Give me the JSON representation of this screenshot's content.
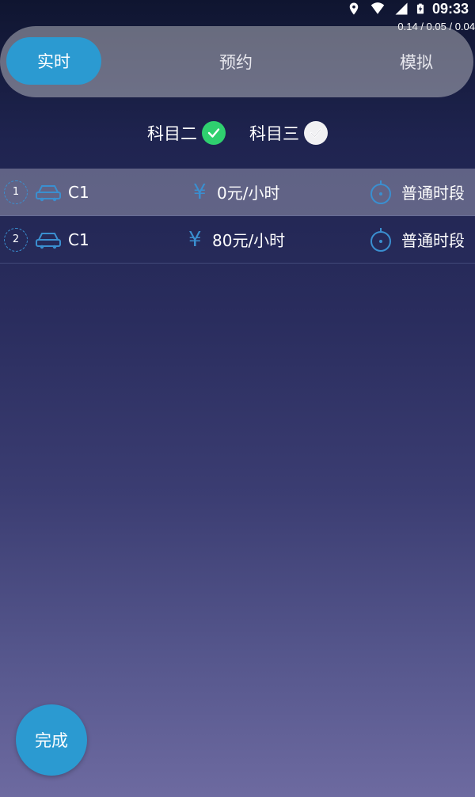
{
  "status": {
    "time": "09:33",
    "net_speed": "0.14 / 0.05 / 0.04"
  },
  "tabs": [
    {
      "label": "实时",
      "active": true
    },
    {
      "label": "预约",
      "active": false
    },
    {
      "label": "模拟",
      "active": false
    }
  ],
  "subjects": [
    {
      "label": "科目二",
      "checked": true,
      "check_color": "#2fd06f"
    },
    {
      "label": "科目三",
      "checked": true,
      "check_color": "#f1f1f3"
    }
  ],
  "list": {
    "rows": [
      {
        "index": "1",
        "class": "C1",
        "yen": "¥",
        "price": "0元/小时",
        "period": "普通时段",
        "selected": true
      },
      {
        "index": "2",
        "class": "C1",
        "yen": "¥",
        "price": "80元/小时",
        "period": "普通时段",
        "selected": false
      }
    ]
  },
  "done_button": {
    "label": "完成"
  },
  "colors": {
    "accent": "#2b9ad1",
    "icon_blue": "#3a8fd0",
    "check_green": "#2fd06f"
  }
}
